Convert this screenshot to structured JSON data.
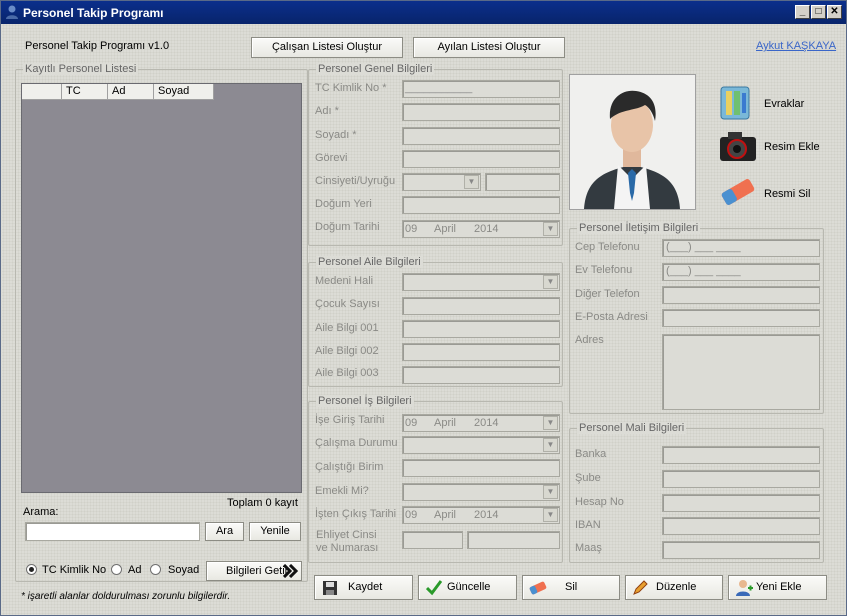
{
  "window": {
    "title": "Personel Takip Programı",
    "minimize": "_",
    "maximize": "□",
    "close": "✕"
  },
  "header": {
    "version": "Personel Takip Programı v1.0",
    "btn_calisan": "Çalışan Listesi Oluştur",
    "btn_ayilan": "Ayılan Listesi Oluştur",
    "author_link": "Aykut KAŞKAYA"
  },
  "list_group": {
    "title": "Kayıtlı Personel Listesi",
    "columns": [
      "TC",
      "Ad",
      "Soyad"
    ],
    "count_text": "Toplam 0 kayıt",
    "search_label": "Arama:",
    "search_value": "",
    "btn_ara": "Ara",
    "btn_yenile": "Yenile",
    "radio": [
      "TC Kimlik No",
      "Ad",
      "Soyad"
    ],
    "selected_radio": "TC Kimlik No",
    "btn_getir": "Bilgileri Getir",
    "note": "* işaretli alanlar doldurulması zorunlu bilgilerdir."
  },
  "genel": {
    "title": "Personel Genel Bilgileri",
    "tc_label": "TC Kimlik No *",
    "tc_mask": "___________",
    "ad_label": "Adı *",
    "soyad_label": "Soyadı *",
    "gorevi_label": "Görevi",
    "cinsiyet_label": "Cinsiyeti/Uyruğu",
    "dogum_yeri_label": "Doğum Yeri",
    "dogum_tarihi_label": "Doğum Tarihi",
    "dogum_tarihi": {
      "day": "09",
      "month": "April",
      "year": "2014"
    }
  },
  "aile": {
    "title": "Personel Aile Bilgileri",
    "medeni_label": "Medeni Hali",
    "cocuk_label": "Çocuk Sayısı",
    "bilgi1": "Aile Bilgi 001",
    "bilgi2": "Aile Bilgi 002",
    "bilgi3": "Aile Bilgi 003"
  },
  "is": {
    "title": "Personel İş Bilgileri",
    "giris_label": "İşe Giriş Tarihi",
    "giris": {
      "day": "09",
      "month": "April",
      "year": "2014"
    },
    "calisma_label": "Çalışma Durumu",
    "birim_label": "Çalıştığı Birim",
    "emekli_label": "Emekli Mi?",
    "cikis_label": "İşten Çıkış Tarihi",
    "cikis": {
      "day": "09",
      "month": "April",
      "year": "2014"
    },
    "ehliyet_label1": "Ehliyet Cinsi",
    "ehliyet_label2": "ve Numarası"
  },
  "side": {
    "evraklar": "Evraklar",
    "resim_ekle": "Resim Ekle",
    "resmi_sil": "Resmi Sil"
  },
  "iletisim": {
    "title": "Personel İletişim Bilgileri",
    "cep_label": "Cep Telefonu",
    "cep_mask": "(___) ___ ____",
    "ev_label": "Ev Telefonu",
    "ev_mask": "(___) ___ ____",
    "diger_label": "Diğer Telefon",
    "eposta_label": "E-Posta Adresi",
    "adres_label": "Adres"
  },
  "mali": {
    "title": "Personel Mali Bilgileri",
    "banka_label": "Banka",
    "sube_label": "Şube",
    "hesap_label": "Hesap No",
    "iban_label": "IBAN",
    "maas_label": "Maaş"
  },
  "actions": {
    "kaydet": "Kaydet",
    "guncelle": "Güncelle",
    "sil": "Sil",
    "duzenle": "Düzenle",
    "yeni_ekle": "Yeni Ekle"
  }
}
